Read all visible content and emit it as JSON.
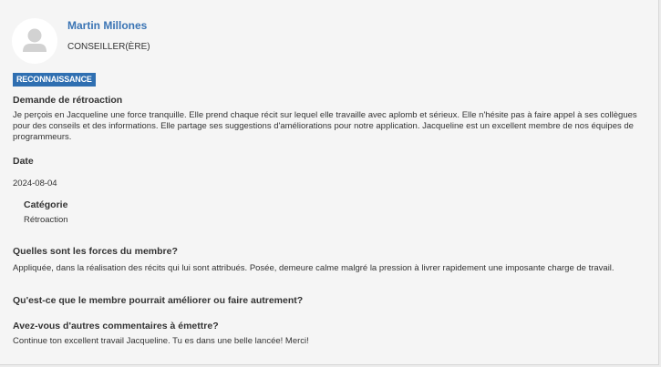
{
  "member": {
    "name": "Martin Millones",
    "role": "CONSEILLER(ÈRE)"
  },
  "badge": "RECONNAISSANCE",
  "feedback": {
    "label": "Demande de rétroaction",
    "text": "Je perçois en Jacqueline une force tranquille. Elle prend chaque récit sur lequel elle travaille avec aplomb et sérieux. Elle n'hésite pas à faire appel à ses collègues pour des conseils et des informations. Elle partage ses suggestions d'améliorations pour notre application. Jacqueline est un excellent membre de nos équipes de programmeurs."
  },
  "date": {
    "label": "Date",
    "value": "2024-08-04"
  },
  "category": {
    "label": "Catégorie",
    "value": "Rétroaction"
  },
  "questions": {
    "strengths": {
      "label": "Quelles sont les forces du membre?",
      "answer": "Appliquée, dans la réalisation des récits qui lui sont attribués. Posée, demeure calme malgré la pression à livrer rapidement une imposante charge de travail."
    },
    "improve": {
      "label": "Qu'est-ce que le membre pourrait améliorer ou faire autrement?"
    },
    "comments": {
      "label": "Avez-vous d'autres commentaires à émettre?",
      "answer": "Continue ton excellent travail Jacqueline. Tu es dans une belle lancée! Merci!"
    }
  }
}
